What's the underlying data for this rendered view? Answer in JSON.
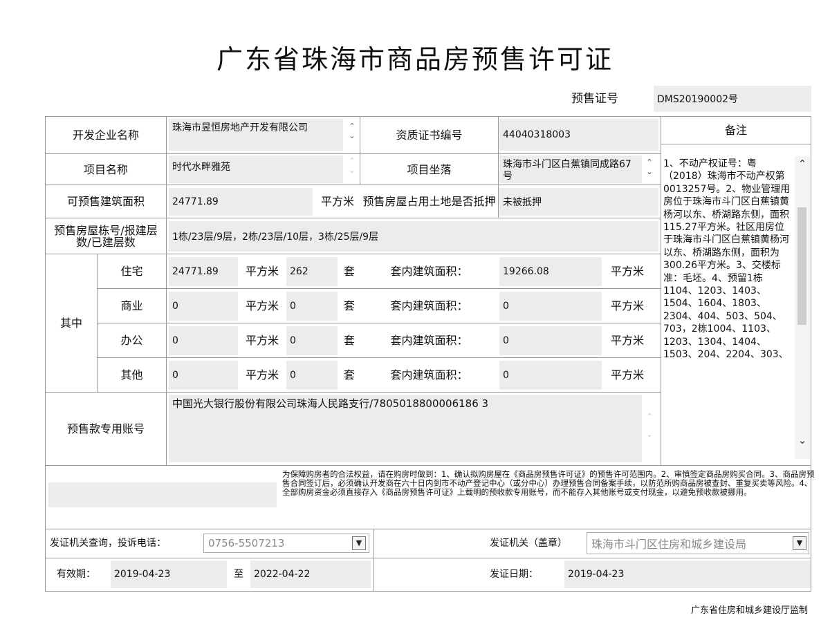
{
  "title": "广东省珠海市商品房预售许可证",
  "presale_no_label": "预售证号",
  "presale_no_value": "DMS20190002号",
  "developer_label": "开发企业名称",
  "developer_value": "珠海市昱恒房地产开发有限公司",
  "qual_label": "资质证书编号",
  "qual_value": "44040318003",
  "remark_header": "备注",
  "project_name_label": "项目名称",
  "project_name_value": "时代水畔雅苑",
  "location_label": "项目坐落",
  "location_value": "珠海市斗门区白蕉镇同成路67号",
  "area_label": "可预售建筑面积",
  "area_value": "24771.89",
  "area_unit": "平方米",
  "mortgage_label": "预售房屋占用土地是否抵押",
  "mortgage_value": "未被抵押",
  "building_label": "预售房屋栋号/报建层数/已建层数",
  "building_value": "1栋/23层/9层，2栋/23层/10层，3栋/25层/9层",
  "among_label": "其中",
  "rows": [
    {
      "type": "住宅",
      "area": "24771.89",
      "unit": "平方米",
      "count": "262",
      "count_unit": "套",
      "inner_label": "套内建筑面积：",
      "inner": "19266.08",
      "inner_unit": "平方米"
    },
    {
      "type": "商业",
      "area": "0",
      "unit": "平方米",
      "count": "0",
      "count_unit": "套",
      "inner_label": "套内建筑面积：",
      "inner": "0",
      "inner_unit": "平方米"
    },
    {
      "type": "办公",
      "area": "0",
      "unit": "平方米",
      "count": "0",
      "count_unit": "套",
      "inner_label": "套内建筑面积：",
      "inner": "0",
      "inner_unit": "平方米"
    },
    {
      "type": "其他",
      "area": "0",
      "unit": "平方米",
      "count": "0",
      "count_unit": "套",
      "inner_label": "套内建筑面积：",
      "inner": "0",
      "inner_unit": "平方米"
    }
  ],
  "account_label": "预售款专用账号",
  "account_value": "中国光大银行股份有限公司珠海人民路支行/7805018800006186 3",
  "remarks_text": "1、不动产权证号：粤（2018）珠海市不动产权第0013257号。2、物业管理用房位于珠海市斗门区白蕉镇黄杨河以东、桥湖路东侧，面积115.27平方米。社区用房位于珠海市斗门区白蕉镇黄杨河以东、桥湖路东侧，面积为300.26平方米。3、交楼标准：毛坯。4、预留1栋1104、1203、1403、1504、1604、1803、2304、404、503、504、703，2栋1004、1103、1203、1304、1404、1503、204、2204、303、",
  "notice_text": "为保障购房者的合法权益，请在购房时做到：1、确认拟购房屋在《商品房预售许可证》的预售许可范围内。2、审慎签定商品房购买合同。3、商品房预售合同签订后，必须确认开发商在六十日内到市不动产登记中心（或分中心）办理预售合同备案手续，以防范所购商品房被查封、重复买卖等风险。4、全部购房资金必须直接存入《商品房预售许可证》上载明的预收款专用账号，而不能存入其他账号或支付现金，以避免预收款被挪用。",
  "phone_label": "发证机关查询，投诉电话：",
  "phone_value": "0756-5507213",
  "issuer_label": "发证机关（盖章）",
  "issuer_value": "珠海市斗门区住房和城乡建设局",
  "valid_label": "有效期：",
  "valid_from": "2019-04-23",
  "valid_to_label": "至",
  "valid_to": "2022-04-22",
  "issue_date_label": "发证日期：",
  "issue_date": "2019-04-23",
  "footer": "广东省住房和城乡建设厅监制"
}
